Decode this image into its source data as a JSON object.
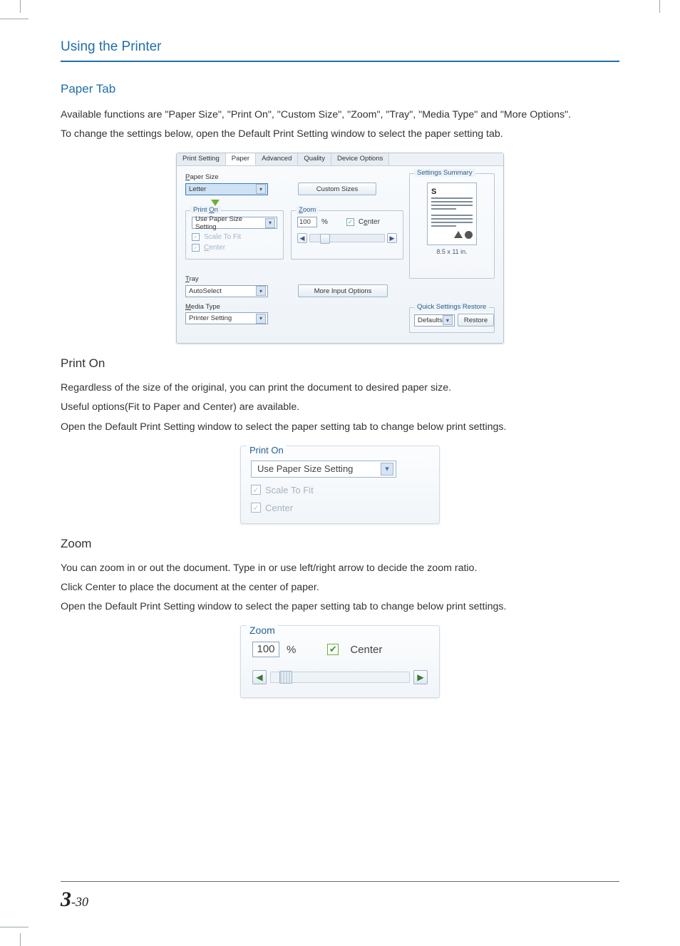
{
  "header": {
    "chapter": "Using the Printer"
  },
  "paperTab": {
    "heading": "Paper Tab",
    "p1": "Available functions are \"Paper Size\", \"Print On\", \"Custom Size\", \"Zoom\", \"Tray\", \"Media Type\" and \"More Options\".",
    "p2": "To change the settings below, open the Default Print Setting window to select the paper setting tab."
  },
  "dialog": {
    "tabs": {
      "printSetting": "Print Setting",
      "paper": "Paper",
      "advanced": "Advanced",
      "quality": "Quality",
      "deviceOptions": "Device Options"
    },
    "paperSize": {
      "legend": "Paper Size",
      "value": "Letter",
      "customBtn": "Custom Sizes"
    },
    "printOn": {
      "legend": "Print On",
      "value": "Use Paper Size Setting",
      "scaleToFit": "Scale To Fit",
      "center": "Center"
    },
    "zoom": {
      "legend": "Zoom",
      "value": "100",
      "percent": "%",
      "center": "Center"
    },
    "tray": {
      "legend": "Tray",
      "value": "AutoSelect",
      "moreBtn": "More Input Options"
    },
    "mediaType": {
      "legend": "Media Type",
      "value": "Printer Setting"
    },
    "summary": {
      "legend": "Settings Summary",
      "dims": "8.5 x 11 in."
    },
    "restore": {
      "legend": "Quick Settings Restore",
      "value": "Defaults",
      "btn": "Restore"
    }
  },
  "printOn": {
    "heading": "Print On",
    "p1": "Regardless of the size of the original, you can print the document to desired paper size.",
    "p2": "Useful options(Fit to Paper and Center) are available.",
    "p3": "Open the Default Print Setting window to select the paper setting tab to change below print settings.",
    "fig": {
      "legend": "Print On",
      "value": "Use Paper Size Setting",
      "scaleToFit": "Scale To Fit",
      "center": "Center"
    }
  },
  "zoom": {
    "heading": "Zoom",
    "p1": "You can zoom in or out the document. Type in or use left/right arrow to decide the zoom ratio.",
    "p2": "Click Center to place the document at the center of paper.",
    "p3": "Open the Default Print Setting window to select the paper setting tab to change below print settings.",
    "fig": {
      "legend": "Zoom",
      "value": "100",
      "percent": "%",
      "center": "Center"
    }
  },
  "footer": {
    "chapter": "3",
    "page": "-30"
  }
}
